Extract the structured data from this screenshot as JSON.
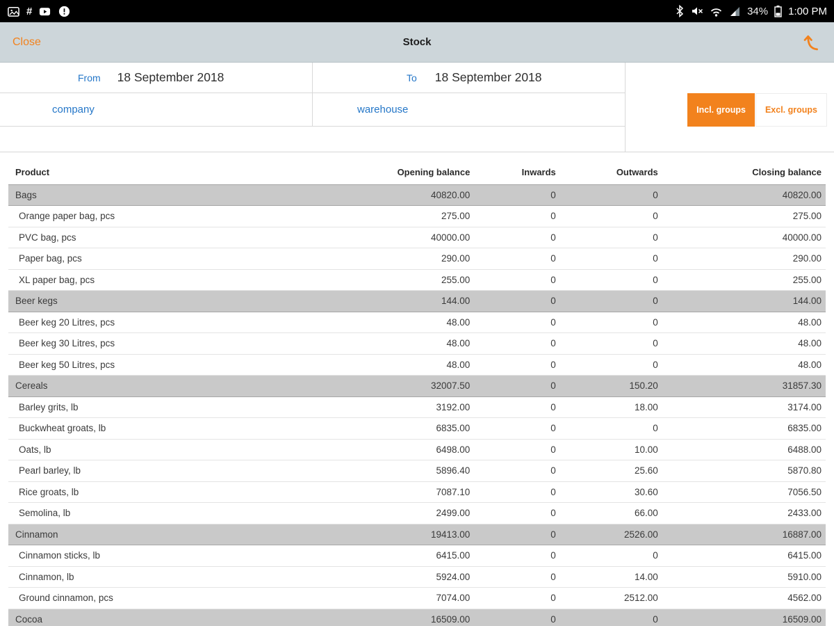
{
  "status_bar": {
    "battery": "34%",
    "time": "1:00 PM",
    "left_icons": [
      "screenshot-icon",
      "hash-icon",
      "youtube-icon",
      "alert-icon"
    ],
    "right_icons": [
      "bluetooth-icon",
      "mute-icon",
      "wifi-icon",
      "signal-icon",
      "battery-icon"
    ]
  },
  "header": {
    "close": "Close",
    "title": "Stock",
    "export_icon": "export-up-arrow-icon"
  },
  "filters": {
    "from_label": "From",
    "from_value": "18 September 2018",
    "to_label": "To",
    "to_value": "18 September 2018",
    "company": "company",
    "warehouse": "warehouse",
    "incl_groups": "Incl. groups",
    "excl_groups": "Excl. groups"
  },
  "colors": {
    "accent_orange": "#F2821D",
    "link_blue": "#2577C8",
    "header_bg": "#CDD6DA",
    "group_row_bg": "#C9C9C9"
  },
  "table": {
    "columns": [
      "Product",
      "Opening balance",
      "Inwards",
      "Outwards",
      "Closing balance"
    ],
    "rows": [
      {
        "product": "Bags",
        "opening": "40820.00",
        "inwards": "0",
        "outwards": "0",
        "closing": "40820.00",
        "group": true
      },
      {
        "product": "Orange paper bag, pcs",
        "opening": "275.00",
        "inwards": "0",
        "outwards": "0",
        "closing": "275.00",
        "group": false
      },
      {
        "product": "PVC bag, pcs",
        "opening": "40000.00",
        "inwards": "0",
        "outwards": "0",
        "closing": "40000.00",
        "group": false
      },
      {
        "product": "Paper bag, pcs",
        "opening": "290.00",
        "inwards": "0",
        "outwards": "0",
        "closing": "290.00",
        "group": false
      },
      {
        "product": "XL paper bag, pcs",
        "opening": "255.00",
        "inwards": "0",
        "outwards": "0",
        "closing": "255.00",
        "group": false
      },
      {
        "product": "Beer kegs",
        "opening": "144.00",
        "inwards": "0",
        "outwards": "0",
        "closing": "144.00",
        "group": true
      },
      {
        "product": "Beer keg 20 Litres, pcs",
        "opening": "48.00",
        "inwards": "0",
        "outwards": "0",
        "closing": "48.00",
        "group": false
      },
      {
        "product": "Beer keg 30 Litres, pcs",
        "opening": "48.00",
        "inwards": "0",
        "outwards": "0",
        "closing": "48.00",
        "group": false
      },
      {
        "product": "Beer keg 50 Litres, pcs",
        "opening": "48.00",
        "inwards": "0",
        "outwards": "0",
        "closing": "48.00",
        "group": false
      },
      {
        "product": "Cereals",
        "opening": "32007.50",
        "inwards": "0",
        "outwards": "150.20",
        "closing": "31857.30",
        "group": true
      },
      {
        "product": "Barley grits, lb",
        "opening": "3192.00",
        "inwards": "0",
        "outwards": "18.00",
        "closing": "3174.00",
        "group": false
      },
      {
        "product": "Buckwheat groats, lb",
        "opening": "6835.00",
        "inwards": "0",
        "outwards": "0",
        "closing": "6835.00",
        "group": false
      },
      {
        "product": "Oats, lb",
        "opening": "6498.00",
        "inwards": "0",
        "outwards": "10.00",
        "closing": "6488.00",
        "group": false
      },
      {
        "product": "Pearl barley, lb",
        "opening": "5896.40",
        "inwards": "0",
        "outwards": "25.60",
        "closing": "5870.80",
        "group": false
      },
      {
        "product": "Rice groats, lb",
        "opening": "7087.10",
        "inwards": "0",
        "outwards": "30.60",
        "closing": "7056.50",
        "group": false
      },
      {
        "product": "Semolina, lb",
        "opening": "2499.00",
        "inwards": "0",
        "outwards": "66.00",
        "closing": "2433.00",
        "group": false
      },
      {
        "product": "Cinnamon",
        "opening": "19413.00",
        "inwards": "0",
        "outwards": "2526.00",
        "closing": "16887.00",
        "group": true
      },
      {
        "product": "Cinnamon sticks, lb",
        "opening": "6415.00",
        "inwards": "0",
        "outwards": "0",
        "closing": "6415.00",
        "group": false
      },
      {
        "product": "Cinnamon, lb",
        "opening": "5924.00",
        "inwards": "0",
        "outwards": "14.00",
        "closing": "5910.00",
        "group": false
      },
      {
        "product": "Ground cinnamon, pcs",
        "opening": "7074.00",
        "inwards": "0",
        "outwards": "2512.00",
        "closing": "4562.00",
        "group": false
      },
      {
        "product": "Cocoa",
        "opening": "16509.00",
        "inwards": "0",
        "outwards": "0",
        "closing": "16509.00",
        "group": true
      }
    ]
  }
}
